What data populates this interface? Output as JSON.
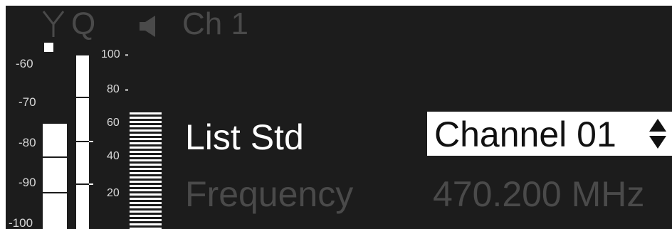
{
  "status": {
    "antenna_icon": "antenna-icon",
    "q_label": "Q",
    "speaker_icon": "speaker-icon",
    "channel_label": "Ch 1"
  },
  "af_scale": [
    "-60",
    "-70",
    "-80",
    "-90",
    "-100"
  ],
  "rf_scale": [
    "100",
    "80",
    "60",
    "40",
    "20"
  ],
  "meters": {
    "af_level_percent": 55,
    "rf_level_percent": 100,
    "stripe_level_percent": 60
  },
  "menu": {
    "item_1_label": "List Std",
    "item_1_value": "Channel 01",
    "item_2_label": "Frequency",
    "item_2_value": "470.200 MHz",
    "value_adjust_icon": "up-down-arrows-icon"
  },
  "colors": {
    "background": "#1c1c1c",
    "active_text": "#ffffff",
    "inactive_text": "#4a4a4a",
    "highlight_box": "#ffffff"
  }
}
